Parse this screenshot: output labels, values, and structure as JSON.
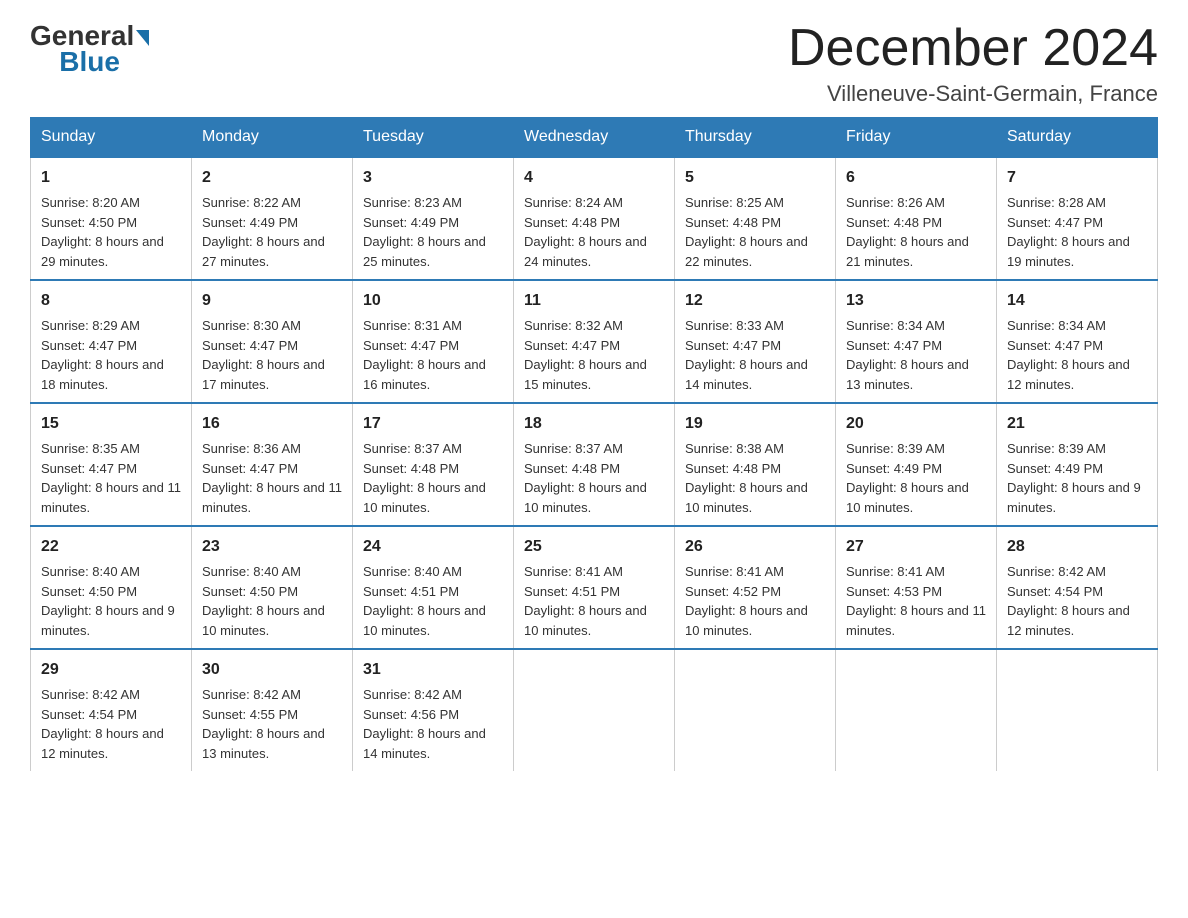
{
  "header": {
    "logo": {
      "general": "General",
      "blue": "Blue"
    },
    "title": "December 2024",
    "subtitle": "Villeneuve-Saint-Germain, France"
  },
  "days_of_week": [
    "Sunday",
    "Monday",
    "Tuesday",
    "Wednesday",
    "Thursday",
    "Friday",
    "Saturday"
  ],
  "weeks": [
    [
      {
        "day": "1",
        "sunrise": "8:20 AM",
        "sunset": "4:50 PM",
        "daylight": "8 hours and 29 minutes."
      },
      {
        "day": "2",
        "sunrise": "8:22 AM",
        "sunset": "4:49 PM",
        "daylight": "8 hours and 27 minutes."
      },
      {
        "day": "3",
        "sunrise": "8:23 AM",
        "sunset": "4:49 PM",
        "daylight": "8 hours and 25 minutes."
      },
      {
        "day": "4",
        "sunrise": "8:24 AM",
        "sunset": "4:48 PM",
        "daylight": "8 hours and 24 minutes."
      },
      {
        "day": "5",
        "sunrise": "8:25 AM",
        "sunset": "4:48 PM",
        "daylight": "8 hours and 22 minutes."
      },
      {
        "day": "6",
        "sunrise": "8:26 AM",
        "sunset": "4:48 PM",
        "daylight": "8 hours and 21 minutes."
      },
      {
        "day": "7",
        "sunrise": "8:28 AM",
        "sunset": "4:47 PM",
        "daylight": "8 hours and 19 minutes."
      }
    ],
    [
      {
        "day": "8",
        "sunrise": "8:29 AM",
        "sunset": "4:47 PM",
        "daylight": "8 hours and 18 minutes."
      },
      {
        "day": "9",
        "sunrise": "8:30 AM",
        "sunset": "4:47 PM",
        "daylight": "8 hours and 17 minutes."
      },
      {
        "day": "10",
        "sunrise": "8:31 AM",
        "sunset": "4:47 PM",
        "daylight": "8 hours and 16 minutes."
      },
      {
        "day": "11",
        "sunrise": "8:32 AM",
        "sunset": "4:47 PM",
        "daylight": "8 hours and 15 minutes."
      },
      {
        "day": "12",
        "sunrise": "8:33 AM",
        "sunset": "4:47 PM",
        "daylight": "8 hours and 14 minutes."
      },
      {
        "day": "13",
        "sunrise": "8:34 AM",
        "sunset": "4:47 PM",
        "daylight": "8 hours and 13 minutes."
      },
      {
        "day": "14",
        "sunrise": "8:34 AM",
        "sunset": "4:47 PM",
        "daylight": "8 hours and 12 minutes."
      }
    ],
    [
      {
        "day": "15",
        "sunrise": "8:35 AM",
        "sunset": "4:47 PM",
        "daylight": "8 hours and 11 minutes."
      },
      {
        "day": "16",
        "sunrise": "8:36 AM",
        "sunset": "4:47 PM",
        "daylight": "8 hours and 11 minutes."
      },
      {
        "day": "17",
        "sunrise": "8:37 AM",
        "sunset": "4:48 PM",
        "daylight": "8 hours and 10 minutes."
      },
      {
        "day": "18",
        "sunrise": "8:37 AM",
        "sunset": "4:48 PM",
        "daylight": "8 hours and 10 minutes."
      },
      {
        "day": "19",
        "sunrise": "8:38 AM",
        "sunset": "4:48 PM",
        "daylight": "8 hours and 10 minutes."
      },
      {
        "day": "20",
        "sunrise": "8:39 AM",
        "sunset": "4:49 PM",
        "daylight": "8 hours and 10 minutes."
      },
      {
        "day": "21",
        "sunrise": "8:39 AM",
        "sunset": "4:49 PM",
        "daylight": "8 hours and 9 minutes."
      }
    ],
    [
      {
        "day": "22",
        "sunrise": "8:40 AM",
        "sunset": "4:50 PM",
        "daylight": "8 hours and 9 minutes."
      },
      {
        "day": "23",
        "sunrise": "8:40 AM",
        "sunset": "4:50 PM",
        "daylight": "8 hours and 10 minutes."
      },
      {
        "day": "24",
        "sunrise": "8:40 AM",
        "sunset": "4:51 PM",
        "daylight": "8 hours and 10 minutes."
      },
      {
        "day": "25",
        "sunrise": "8:41 AM",
        "sunset": "4:51 PM",
        "daylight": "8 hours and 10 minutes."
      },
      {
        "day": "26",
        "sunrise": "8:41 AM",
        "sunset": "4:52 PM",
        "daylight": "8 hours and 10 minutes."
      },
      {
        "day": "27",
        "sunrise": "8:41 AM",
        "sunset": "4:53 PM",
        "daylight": "8 hours and 11 minutes."
      },
      {
        "day": "28",
        "sunrise": "8:42 AM",
        "sunset": "4:54 PM",
        "daylight": "8 hours and 12 minutes."
      }
    ],
    [
      {
        "day": "29",
        "sunrise": "8:42 AM",
        "sunset": "4:54 PM",
        "daylight": "8 hours and 12 minutes."
      },
      {
        "day": "30",
        "sunrise": "8:42 AM",
        "sunset": "4:55 PM",
        "daylight": "8 hours and 13 minutes."
      },
      {
        "day": "31",
        "sunrise": "8:42 AM",
        "sunset": "4:56 PM",
        "daylight": "8 hours and 14 minutes."
      },
      null,
      null,
      null,
      null
    ]
  ],
  "labels": {
    "sunrise": "Sunrise:",
    "sunset": "Sunset:",
    "daylight": "Daylight:"
  }
}
